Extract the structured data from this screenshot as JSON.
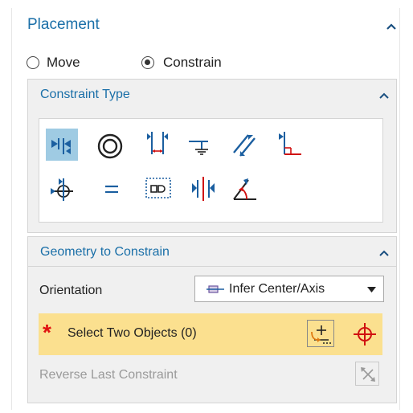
{
  "placement": {
    "title": "Placement",
    "radio_move": "Move",
    "radio_constrain": "Constrain",
    "selected": "Constrain"
  },
  "constraint_type": {
    "title": "Constraint Type",
    "icons": [
      "touch-align-icon",
      "concentric-icon",
      "distance-icon",
      "fix-icon",
      "parallel-icon",
      "perpendicular-icon",
      "align-lock-icon",
      "equal-icon",
      "fit-icon",
      "center-icon",
      "angle-icon"
    ],
    "selected_icon": "touch-align-icon"
  },
  "geometry": {
    "title": "Geometry to Constrain",
    "orientation_label": "Orientation",
    "orientation_value": "Infer Center/Axis",
    "select_label": "Select Two Objects (0)",
    "select_required_marker": "*",
    "reverse_label": "Reverse Last Constraint"
  },
  "colors": {
    "accent": "#1a6fa8",
    "selected_icon_bg": "#9fcbe3",
    "select_row_bg": "#fbe08f",
    "required_red": "#e01010"
  }
}
